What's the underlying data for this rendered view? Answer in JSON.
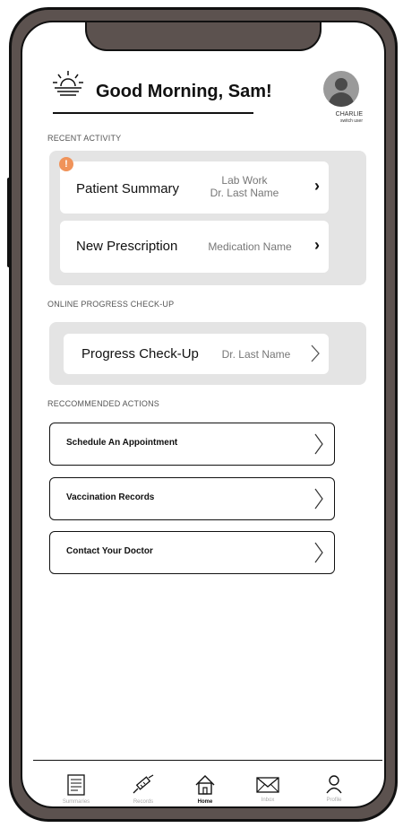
{
  "header": {
    "greeting": "Good Morning, Sam!",
    "user_name": "CHARLIE",
    "switch_user": "switch user"
  },
  "recent_activity": {
    "label": "RECENT ACTIVITY",
    "items": [
      {
        "title": "Patient Summary",
        "sub1": "Lab Work",
        "sub2": "Dr. Last Name",
        "alert": "!"
      },
      {
        "title": "New Prescription",
        "sub1": "Medication Name"
      }
    ]
  },
  "online_checkup": {
    "label": "ONLINE PROGRESS CHECK-UP",
    "item": {
      "title": "Progress Check-Up",
      "sub": "Dr. Last Name"
    }
  },
  "recommended": {
    "label": "RECCOMMENDED ACTIONS",
    "items": [
      {
        "label": "Schedule An Appointment"
      },
      {
        "label": "Vaccination Records"
      },
      {
        "label": "Contact Your Doctor"
      }
    ]
  },
  "nav": {
    "items": [
      {
        "label": "Summaries",
        "icon": "document-icon"
      },
      {
        "label": "Records",
        "icon": "syringe-icon"
      },
      {
        "label": "Home",
        "icon": "home-icon",
        "active": true
      },
      {
        "label": "Inbox",
        "icon": "envelope-icon"
      },
      {
        "label": "Profile",
        "icon": "person-icon"
      }
    ]
  },
  "colors": {
    "frame": "#5c524f",
    "panel": "#e4e4e4",
    "alert": "#f0935a"
  }
}
